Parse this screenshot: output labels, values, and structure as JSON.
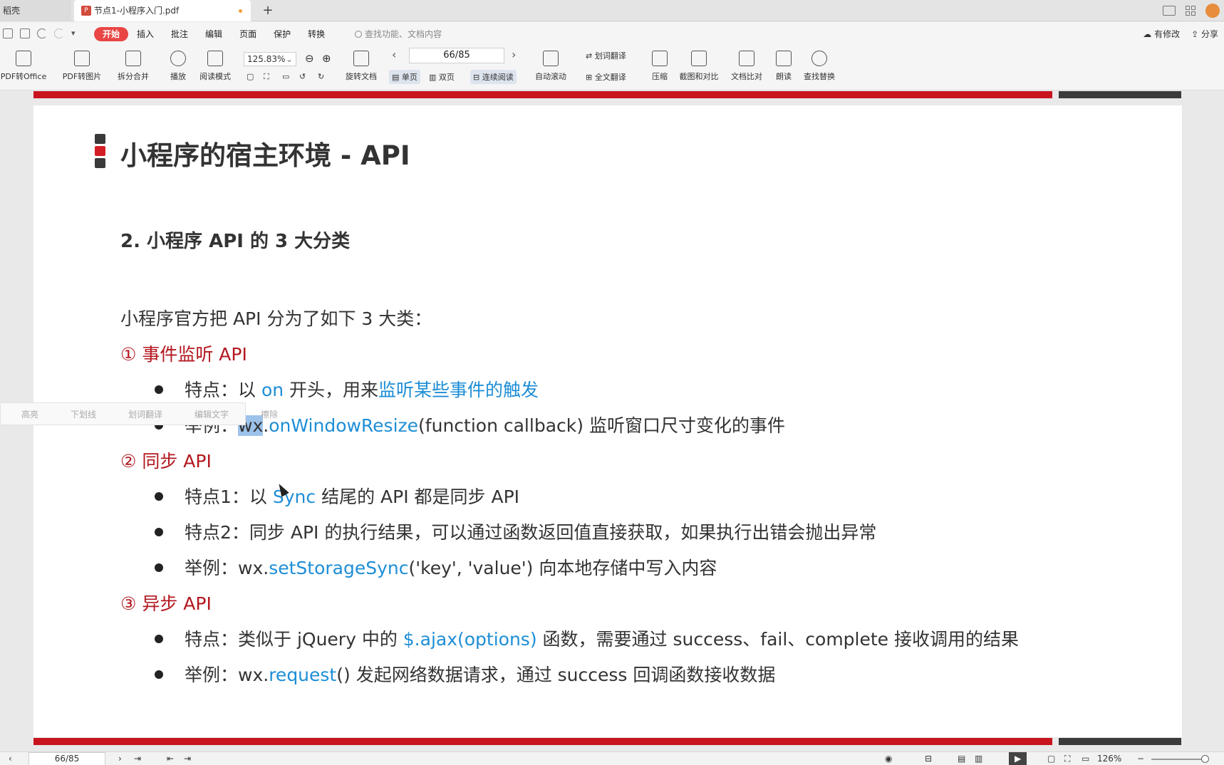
{
  "tabs": {
    "inactive_label": "稻壳",
    "active_label": "节点1-小程序入门.pdf",
    "new_tab": "+"
  },
  "menu": {
    "items": [
      "开始",
      "插入",
      "批注",
      "编辑",
      "页面",
      "保护",
      "转换"
    ],
    "search_placeholder": "查找功能、文档内容",
    "status_modified": "有修改",
    "share": "分享"
  },
  "toolbar": {
    "pdf_to_office": "PDF转Office",
    "pdf_to_image": "PDF转图片",
    "split_merge": "拆分合并",
    "play": "播放",
    "read_mode": "阅读模式",
    "zoom": "125.83%",
    "rotate": "旋转文档",
    "page": "66/85",
    "single_page": "单页",
    "double_page": "双页",
    "continuous": "连续阅读",
    "auto_scroll": "自动滚动",
    "word_translate": "划词翻译",
    "full_translate": "全文翻译",
    "compress": "压缩",
    "screenshot_compare": "截图和对比",
    "doc_compare": "文档比对",
    "read_aloud": "朗读",
    "find_replace": "查找替换"
  },
  "document": {
    "title": "小程序的宿主环境 - API",
    "subtitle": "2. 小程序 API 的 3 大分类",
    "intro": "小程序官方把 API 分为了如下 3 大类：",
    "cat1": "①  事件监听 API",
    "cat1_b1_a": "特点：以 ",
    "cat1_b1_on": "on",
    "cat1_b1_b": " 开头，用来",
    "cat1_b1_c": "监听某些事件的触发",
    "cat1_b2_a": "举例：",
    "cat1_b2_wx": "wx",
    "cat1_b2_dot": ".",
    "cat1_b2_fn": "onWindowResize",
    "cat1_b2_b": "(function callback) 监听窗口尺寸变化的事件",
    "cat2": "②  同步 API",
    "cat2_b1_a": "特点1：以 ",
    "cat2_b1_sync": "Sync",
    "cat2_b1_b": " 结尾的 API 都是同步 API",
    "cat2_b2": "特点2：同步 API 的执行结果，可以通过函数返回值直接获取，如果执行出错会抛出异常",
    "cat2_b3_a": "举例：wx.",
    "cat2_b3_fn": "setStorageSync",
    "cat2_b3_b": "('key', 'value') 向本地存储中写入内容",
    "cat3": "③  异步 API",
    "cat3_b1_a": "特点：类似于 jQuery 中的 ",
    "cat3_b1_fn": "$.ajax(options)",
    "cat3_b1_b": " 函数，需要通过 success、fail、complete 接收调用的结果",
    "cat3_b2_a": "举例：wx.",
    "cat3_b2_fn": "request",
    "cat3_b2_b": "() 发起网络数据请求，通过 success 回调函数接收数据"
  },
  "floatbar": {
    "highlight": "高亮",
    "underline": "下划线",
    "translate": "划词翻译",
    "edit_text": "编辑文字",
    "erase": "擦除"
  },
  "status": {
    "page": "66/85",
    "zoom": "126%"
  },
  "colors": {
    "accent": "#e94545",
    "red_bar": "#c8141e",
    "category": "#b3171f",
    "link_blue": "#1e8ed6"
  }
}
